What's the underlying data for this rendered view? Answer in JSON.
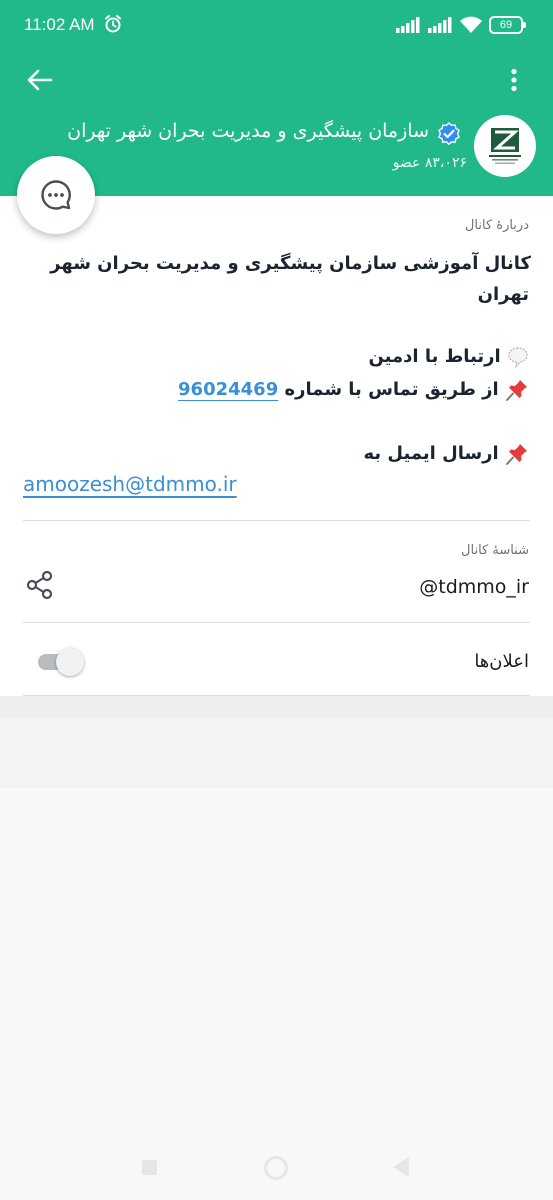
{
  "status_bar": {
    "time": "11:02 AM",
    "battery": "69",
    "icons": [
      "alarm-icon",
      "signal-icon",
      "signal-icon",
      "wifi-icon",
      "battery-icon"
    ]
  },
  "header": {
    "channel_title": "سازمان پیشگیری و مدیریت بحران شهر تهران",
    "members": "۸۳،۰۲۶ عضو",
    "verified": true,
    "icons": [
      "back-arrow-icon",
      "more-vert-icon",
      "verified-icon",
      "chat-icon"
    ]
  },
  "about": {
    "label": "دربارهٔ کانال",
    "description_line1": "کانال آموزشی سازمان پیشگیری و مدیریت بحران شهر",
    "description_line2": "تهران",
    "admin_contact": "ارتباط با ادمین",
    "phone_prefix": "از طریق تماس با شماره",
    "phone": "96024469",
    "email_prefix": "ارسال ایمیل به",
    "email": "amoozesh@tdmmo.ir",
    "emoji": [
      "speech-balloon-icon",
      "pushpin-icon",
      "pushpin-icon"
    ]
  },
  "channel_id": {
    "label": "شناسهٔ کانال",
    "username": "@tdmmo_ir"
  },
  "notifications": {
    "label": "اعلان‌ها",
    "enabled": false
  },
  "colors": {
    "header": "#21b98a",
    "link": "#3a8fd6",
    "verified": "#2f8ff0"
  }
}
